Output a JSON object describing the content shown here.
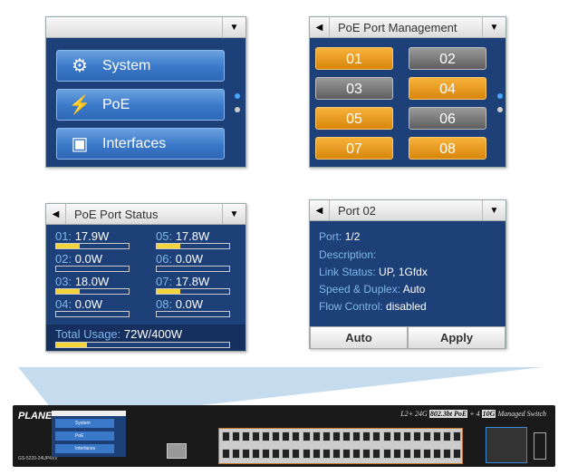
{
  "main_menu": {
    "items": [
      {
        "label": "System",
        "icon": "gear-icon"
      },
      {
        "label": "PoE",
        "icon": "poe-icon"
      },
      {
        "label": "Interfaces",
        "icon": "network-port-icon"
      }
    ]
  },
  "poe_mgmt": {
    "title": "PoE Port Management",
    "ports": [
      {
        "label": "01",
        "on": true
      },
      {
        "label": "02",
        "on": false
      },
      {
        "label": "03",
        "on": false
      },
      {
        "label": "04",
        "on": true
      },
      {
        "label": "05",
        "on": true
      },
      {
        "label": "06",
        "on": false
      },
      {
        "label": "07",
        "on": true
      },
      {
        "label": "08",
        "on": true
      }
    ]
  },
  "poe_status": {
    "title": "PoE Port Status",
    "ports": [
      {
        "id": "01:",
        "value": "17.9W",
        "fill": 0.33
      },
      {
        "id": "02:",
        "value": "0.0W",
        "fill": 0
      },
      {
        "id": "03:",
        "value": "18.0W",
        "fill": 0.33
      },
      {
        "id": "04:",
        "value": "0.0W",
        "fill": 0
      },
      {
        "id": "05:",
        "value": "17.8W",
        "fill": 0.33
      },
      {
        "id": "06:",
        "value": "0.0W",
        "fill": 0
      },
      {
        "id": "07:",
        "value": "17.8W",
        "fill": 0.33
      },
      {
        "id": "08:",
        "value": "0.0W",
        "fill": 0
      }
    ],
    "total_label": "Total Usage:",
    "total_value": "72W/400W",
    "total_fill": 0.18
  },
  "port_detail": {
    "title": "Port 02",
    "fields": [
      {
        "k": "Port:",
        "v": "1/2"
      },
      {
        "k": "Description:",
        "v": ""
      },
      {
        "k": "Link Status:",
        "v": "UP, 1Gfdx"
      },
      {
        "k": "Speed & Duplex:",
        "v": "Auto"
      },
      {
        "k": "Flow Control:",
        "v": "disabled"
      }
    ],
    "buttons": {
      "auto": "Auto",
      "apply": "Apply"
    }
  },
  "switch": {
    "brand": "PLANET",
    "model": "GS-5220-24UP4XV",
    "title_a": "L2+ 24G",
    "title_b": "802.3bt PoE",
    "title_c": "+ 4",
    "title_d": "10G",
    "title_e": "Managed Switch",
    "menu": [
      "System",
      "PoE",
      "Interfaces"
    ]
  },
  "colors": {
    "panel": "#1d4079",
    "poe_on": "#e59a1c",
    "poe_off": "#7a7a7a",
    "bar_fill": "#f5d33a"
  }
}
